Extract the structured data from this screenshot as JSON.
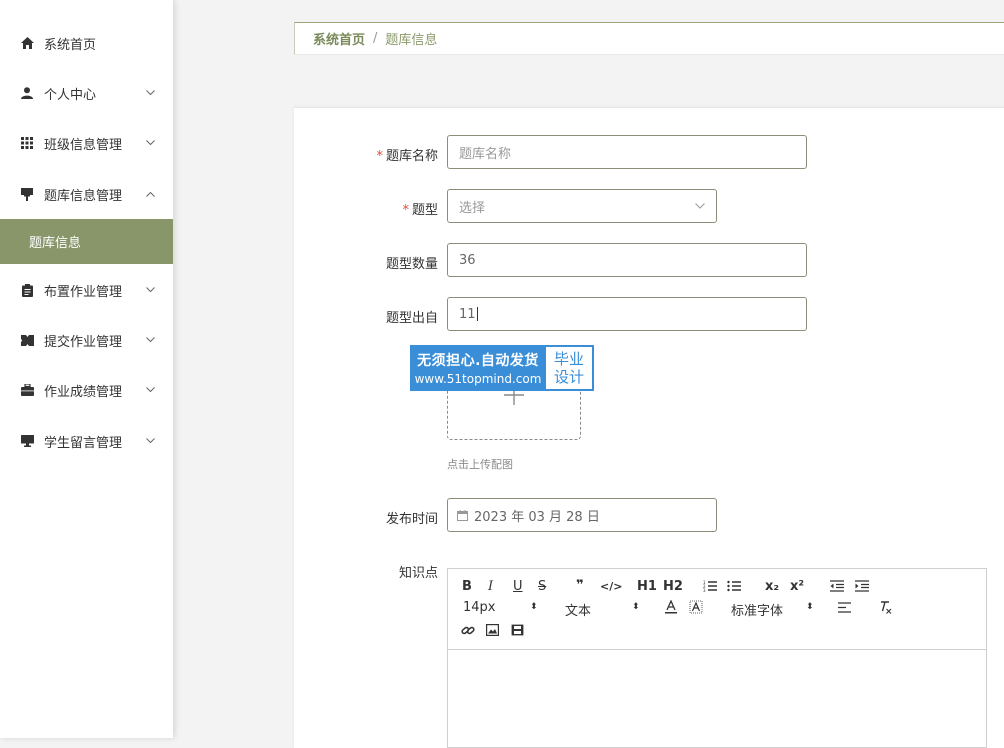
{
  "sidebar": {
    "items": [
      {
        "label": "系统首页",
        "icon": "home-icon"
      },
      {
        "label": "个人中心",
        "icon": "user-icon"
      },
      {
        "label": "班级信息管理",
        "icon": "grid-icon"
      },
      {
        "label": "题库信息管理",
        "icon": "board-icon"
      },
      {
        "label": "布置作业管理",
        "icon": "clipboard-icon"
      },
      {
        "label": "提交作业管理",
        "icon": "ticket-icon"
      },
      {
        "label": "作业成绩管理",
        "icon": "briefcase-icon"
      },
      {
        "label": "学生留言管理",
        "icon": "monitor-icon"
      }
    ],
    "active_sub": "题库信息",
    "accent": "#88966a"
  },
  "breadcrumb": {
    "home": "系统首页",
    "separator": "/",
    "current": "题库信息"
  },
  "form": {
    "name_label": "题库名称",
    "name_placeholder": "题库名称",
    "type_label": "题型",
    "type_placeholder": "选择",
    "count_label": "题型数量",
    "count_value": "36",
    "source_label": "题型出自",
    "source_value": "11",
    "upload_hint": "点击上传配图",
    "date_label": "发布时间",
    "date_value": "2023 年 03 月 28 日",
    "knowledge_label": "知识点",
    "required_mark": "*"
  },
  "watermark": {
    "line1": "无须担心.自动发货",
    "line2": "www.51topmind.com",
    "right1": "毕业",
    "right2": "设计"
  },
  "editor": {
    "font_size": "14px",
    "text_style": "文本",
    "font_family": "标准字体",
    "h1": "H1",
    "h2": "H2",
    "bold": "B",
    "italic": "I",
    "underline": "U",
    "strike": "S",
    "quote": "❞",
    "code": "</>",
    "sub": "x₂",
    "sup": "x²"
  }
}
